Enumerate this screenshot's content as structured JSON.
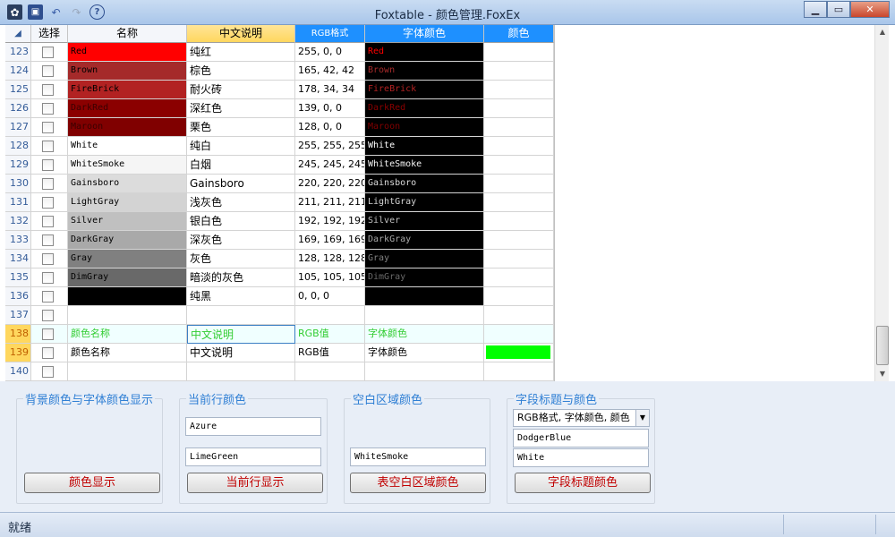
{
  "window": {
    "title": "Foxtable - 颜色管理.FoxEx",
    "minimize": "▁",
    "maximize": "▭",
    "close": "✕"
  },
  "toolbar": {
    "icons": [
      "app-icon",
      "save-icon",
      "undo-icon",
      "redo-icon",
      "help-icon"
    ]
  },
  "columns": {
    "select": "选择",
    "name": "名称",
    "chinese": "中文说明",
    "rgb": "RGB格式",
    "font_color": "字体颜色",
    "color": "颜色"
  },
  "rows": [
    {
      "num": "123",
      "name": "Red",
      "cn": "纯红",
      "rgb": "255, 0, 0",
      "font": "Red",
      "bg": "#ff0000",
      "fg": "#ff0000"
    },
    {
      "num": "124",
      "name": "Brown",
      "cn": "棕色",
      "rgb": "165, 42, 42",
      "font": "Brown",
      "bg": "#a52a2a",
      "fg": "#a52a2a"
    },
    {
      "num": "125",
      "name": "FireBrick",
      "cn": "耐火砖",
      "rgb": "178, 34, 34",
      "font": "FireBrick",
      "bg": "#b22222",
      "fg": "#b22222"
    },
    {
      "num": "126",
      "name": "DarkRed",
      "cn": "深红色",
      "rgb": "139, 0, 0",
      "font": "DarkRed",
      "bg": "#8b0000",
      "fg": "#8b0000"
    },
    {
      "num": "127",
      "name": "Maroon",
      "cn": "栗色",
      "rgb": "128, 0, 0",
      "font": "Maroon",
      "bg": "#800000",
      "fg": "#800000"
    },
    {
      "num": "128",
      "name": "White",
      "cn": "纯白",
      "rgb": "255, 255, 255",
      "font": "White",
      "bg": "#ffffff",
      "fg": "#ffffff"
    },
    {
      "num": "129",
      "name": "WhiteSmoke",
      "cn": "白烟",
      "rgb": "245, 245, 245",
      "font": "WhiteSmoke",
      "bg": "#f5f5f5",
      "fg": "#f5f5f5"
    },
    {
      "num": "130",
      "name": "Gainsboro",
      "cn": "Gainsboro",
      "rgb": "220, 220, 220",
      "font": "Gainsboro",
      "bg": "#dcdcdc",
      "fg": "#dcdcdc"
    },
    {
      "num": "131",
      "name": "LightGray",
      "cn": "浅灰色",
      "rgb": "211, 211, 211",
      "font": "LightGray",
      "bg": "#d3d3d3",
      "fg": "#d3d3d3"
    },
    {
      "num": "132",
      "name": "Silver",
      "cn": "银白色",
      "rgb": "192, 192, 192",
      "font": "Silver",
      "bg": "#c0c0c0",
      "fg": "#c0c0c0"
    },
    {
      "num": "133",
      "name": "DarkGray",
      "cn": "深灰色",
      "rgb": "169, 169, 169",
      "font": "DarkGray",
      "bg": "#a9a9a9",
      "fg": "#a9a9a9"
    },
    {
      "num": "134",
      "name": "Gray",
      "cn": "灰色",
      "rgb": "128, 128, 128",
      "font": "Gray",
      "bg": "#808080",
      "fg": "#808080"
    },
    {
      "num": "135",
      "name": "DimGray",
      "cn": "暗淡的灰色",
      "rgb": "105, 105, 105",
      "font": "DimGray",
      "bg": "#696969",
      "fg": "#696969"
    },
    {
      "num": "136",
      "name": "",
      "cn": "纯黑",
      "rgb": "0, 0, 0",
      "font": "",
      "bg": "#000000",
      "fg": "#000000"
    },
    {
      "num": "137",
      "name": "",
      "cn": "",
      "rgb": "",
      "font": "",
      "bg": "",
      "fg": ""
    },
    {
      "num": "138",
      "name": "颜色名称",
      "cn": "中文说明",
      "rgb": "RGB值",
      "font": "字体颜色",
      "bg": "",
      "fg": ""
    },
    {
      "num": "139",
      "name": "颜色名称",
      "cn": "中文说明",
      "rgb": "RGB值",
      "font": "字体颜色",
      "bg": "",
      "fg": ""
    },
    {
      "num": "140",
      "name": "",
      "cn": "",
      "rgb": "",
      "font": "",
      "bg": "",
      "fg": ""
    }
  ],
  "colors": {
    "header_current": "#ffd75e",
    "header_accent": "#1e90ff",
    "current_row_bg": "#f0ffff",
    "current_row_fg": "#32cd32",
    "row139_color_swatch": "#00ff00",
    "font_column_bg": "#000000"
  },
  "panels": {
    "display": {
      "label": "背景颜色与字体颜色显示",
      "button": "颜色显示"
    },
    "current_row": {
      "label": "当前行颜色",
      "value1": "Azure",
      "value2": "LimeGreen",
      "button": "当前行显示"
    },
    "empty_area": {
      "label": "空白区域颜色",
      "value": "WhiteSmoke",
      "button": "表空白区域颜色"
    },
    "field_title": {
      "label": "字段标题与颜色",
      "select": "RGB格式, 字体颜色, 颜色",
      "value1": "DodgerBlue",
      "value2": "White",
      "button": "字段标题颜色"
    }
  },
  "status": {
    "text": "就绪"
  }
}
